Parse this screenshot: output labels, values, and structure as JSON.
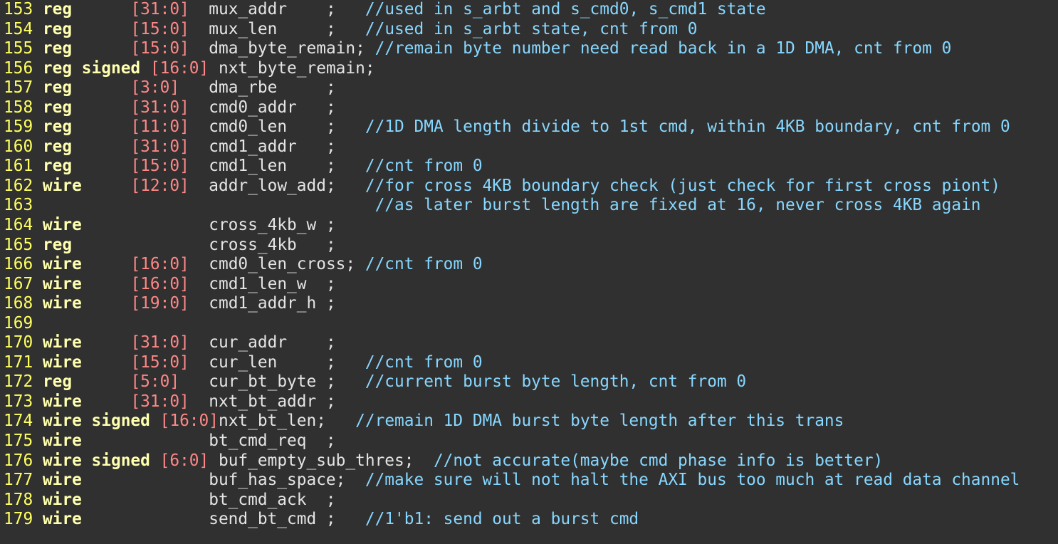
{
  "editor": {
    "lines": [
      [
        {
          "k": "ln",
          "t": "153 "
        },
        {
          "k": "kw",
          "t": "reg"
        },
        {
          "k": "id",
          "t": "      "
        },
        {
          "k": "num",
          "t": "[31:0]"
        },
        {
          "k": "id",
          "t": "  mux_addr    ;   "
        },
        {
          "k": "cmt",
          "t": "//used in s_arbt and s_cmd0, s_cmd1 state"
        }
      ],
      [
        {
          "k": "ln",
          "t": "154 "
        },
        {
          "k": "kw",
          "t": "reg"
        },
        {
          "k": "id",
          "t": "      "
        },
        {
          "k": "num",
          "t": "[15:0]"
        },
        {
          "k": "id",
          "t": "  mux_len     ;   "
        },
        {
          "k": "cmt",
          "t": "//used in s_arbt state, cnt from 0"
        }
      ],
      [
        {
          "k": "ln",
          "t": "155 "
        },
        {
          "k": "kw",
          "t": "reg"
        },
        {
          "k": "id",
          "t": "      "
        },
        {
          "k": "num",
          "t": "[15:0]"
        },
        {
          "k": "id",
          "t": "  dma_byte_remain; "
        },
        {
          "k": "cmt",
          "t": "//remain byte number need read back in a 1D DMA, cnt from 0"
        }
      ],
      [
        {
          "k": "ln",
          "t": "156 "
        },
        {
          "k": "kw",
          "t": "reg signed"
        },
        {
          "k": "id",
          "t": " "
        },
        {
          "k": "num",
          "t": "[16:0]"
        },
        {
          "k": "id",
          "t": " nxt_byte_remain;"
        }
      ],
      [
        {
          "k": "ln",
          "t": "157 "
        },
        {
          "k": "kw",
          "t": "reg"
        },
        {
          "k": "id",
          "t": "      "
        },
        {
          "k": "num",
          "t": "[3:0]"
        },
        {
          "k": "id",
          "t": "   dma_rbe     ;"
        }
      ],
      [
        {
          "k": "ln",
          "t": "158 "
        },
        {
          "k": "kw",
          "t": "reg"
        },
        {
          "k": "id",
          "t": "      "
        },
        {
          "k": "num",
          "t": "[31:0]"
        },
        {
          "k": "id",
          "t": "  cmd0_addr   ;"
        }
      ],
      [
        {
          "k": "ln",
          "t": "159 "
        },
        {
          "k": "kw",
          "t": "reg"
        },
        {
          "k": "id",
          "t": "      "
        },
        {
          "k": "num",
          "t": "[11:0]"
        },
        {
          "k": "id",
          "t": "  cmd0_len    ;   "
        },
        {
          "k": "cmt",
          "t": "//1D DMA length divide to 1st cmd, within 4KB boundary, cnt from 0"
        }
      ],
      [
        {
          "k": "ln",
          "t": "160 "
        },
        {
          "k": "kw",
          "t": "reg"
        },
        {
          "k": "id",
          "t": "      "
        },
        {
          "k": "num",
          "t": "[31:0]"
        },
        {
          "k": "id",
          "t": "  cmd1_addr   ;"
        }
      ],
      [
        {
          "k": "ln",
          "t": "161 "
        },
        {
          "k": "kw",
          "t": "reg"
        },
        {
          "k": "id",
          "t": "      "
        },
        {
          "k": "num",
          "t": "[15:0]"
        },
        {
          "k": "id",
          "t": "  cmd1_len    ;   "
        },
        {
          "k": "cmt",
          "t": "//cnt from 0"
        }
      ],
      [
        {
          "k": "ln",
          "t": "162 "
        },
        {
          "k": "kw",
          "t": "wire"
        },
        {
          "k": "id",
          "t": "     "
        },
        {
          "k": "num",
          "t": "[12:0]"
        },
        {
          "k": "id",
          "t": "  addr_low_add;   "
        },
        {
          "k": "cmt",
          "t": "//for cross 4KB boundary check (just check for first cross piont)"
        }
      ],
      [
        {
          "k": "ln",
          "t": "163 "
        },
        {
          "k": "id",
          "t": "                                  "
        },
        {
          "k": "cmt",
          "t": "//as later burst length are fixed at 16, never cross 4KB again"
        }
      ],
      [
        {
          "k": "ln",
          "t": "164 "
        },
        {
          "k": "kw",
          "t": "wire"
        },
        {
          "k": "id",
          "t": "             cross_4kb_w ;"
        }
      ],
      [
        {
          "k": "ln",
          "t": "165 "
        },
        {
          "k": "kw",
          "t": "reg"
        },
        {
          "k": "id",
          "t": "              cross_4kb   ;"
        }
      ],
      [
        {
          "k": "ln",
          "t": "166 "
        },
        {
          "k": "kw",
          "t": "wire"
        },
        {
          "k": "id",
          "t": "     "
        },
        {
          "k": "num",
          "t": "[16:0]"
        },
        {
          "k": "id",
          "t": "  cmd0_len_cross; "
        },
        {
          "k": "cmt",
          "t": "//cnt from 0"
        }
      ],
      [
        {
          "k": "ln",
          "t": "167 "
        },
        {
          "k": "kw",
          "t": "wire"
        },
        {
          "k": "id",
          "t": "     "
        },
        {
          "k": "num",
          "t": "[16:0]"
        },
        {
          "k": "id",
          "t": "  cmd1_len_w  ;"
        }
      ],
      [
        {
          "k": "ln",
          "t": "168 "
        },
        {
          "k": "kw",
          "t": "wire"
        },
        {
          "k": "id",
          "t": "     "
        },
        {
          "k": "num",
          "t": "[19:0]"
        },
        {
          "k": "id",
          "t": "  cmd1_addr_h ;"
        }
      ],
      [
        {
          "k": "ln",
          "t": "169"
        }
      ],
      [
        {
          "k": "ln",
          "t": "170 "
        },
        {
          "k": "kw",
          "t": "wire"
        },
        {
          "k": "id",
          "t": "     "
        },
        {
          "k": "num",
          "t": "[31:0]"
        },
        {
          "k": "id",
          "t": "  cur_addr    ;"
        }
      ],
      [
        {
          "k": "ln",
          "t": "171 "
        },
        {
          "k": "kw",
          "t": "wire"
        },
        {
          "k": "id",
          "t": "     "
        },
        {
          "k": "num",
          "t": "[15:0]"
        },
        {
          "k": "id",
          "t": "  cur_len     ;   "
        },
        {
          "k": "cmt",
          "t": "//cnt from 0"
        }
      ],
      [
        {
          "k": "ln",
          "t": "172 "
        },
        {
          "k": "kw",
          "t": "reg"
        },
        {
          "k": "id",
          "t": "      "
        },
        {
          "k": "num",
          "t": "[5:0]"
        },
        {
          "k": "id",
          "t": "   cur_bt_byte ;   "
        },
        {
          "k": "cmt",
          "t": "//current burst byte length, cnt from 0"
        }
      ],
      [
        {
          "k": "ln",
          "t": "173 "
        },
        {
          "k": "kw",
          "t": "wire"
        },
        {
          "k": "id",
          "t": "     "
        },
        {
          "k": "num",
          "t": "[31:0]"
        },
        {
          "k": "id",
          "t": "  nxt_bt_addr ;"
        }
      ],
      [
        {
          "k": "ln",
          "t": "174 "
        },
        {
          "k": "kw",
          "t": "wire signed"
        },
        {
          "k": "id",
          "t": " "
        },
        {
          "k": "num",
          "t": "[16:0]"
        },
        {
          "k": "id",
          "t": "nxt_bt_len;   "
        },
        {
          "k": "cmt",
          "t": "//remain 1D DMA burst byte length after this trans"
        }
      ],
      [
        {
          "k": "ln",
          "t": "175 "
        },
        {
          "k": "kw",
          "t": "wire"
        },
        {
          "k": "id",
          "t": "             bt_cmd_req  ;"
        }
      ],
      [
        {
          "k": "ln",
          "t": "176 "
        },
        {
          "k": "kw",
          "t": "wire signed"
        },
        {
          "k": "id",
          "t": " "
        },
        {
          "k": "num",
          "t": "[6:0]"
        },
        {
          "k": "id",
          "t": " buf_empty_sub_thres;  "
        },
        {
          "k": "cmt",
          "t": "//not accurate(maybe cmd phase info is better)"
        }
      ],
      [
        {
          "k": "ln",
          "t": "177 "
        },
        {
          "k": "kw",
          "t": "wire"
        },
        {
          "k": "id",
          "t": "             buf_has_space;  "
        },
        {
          "k": "cmt",
          "t": "//make sure will not halt the AXI bus too much at read data channel"
        }
      ],
      [
        {
          "k": "ln",
          "t": "178 "
        },
        {
          "k": "kw",
          "t": "wire"
        },
        {
          "k": "id",
          "t": "             bt_cmd_ack  ;"
        }
      ],
      [
        {
          "k": "ln",
          "t": "179 "
        },
        {
          "k": "kw",
          "t": "wire"
        },
        {
          "k": "id",
          "t": "             send_bt_cmd ;   "
        },
        {
          "k": "cmt",
          "t": "//1'b1: send out a burst cmd"
        }
      ]
    ],
    "colors": {
      "background": "#303030",
      "line_number": "#ffff5f",
      "keyword": "#ffffaf",
      "range": "#ff8787",
      "identifier": "#e4e4e4",
      "comment": "#87d7ff"
    }
  }
}
